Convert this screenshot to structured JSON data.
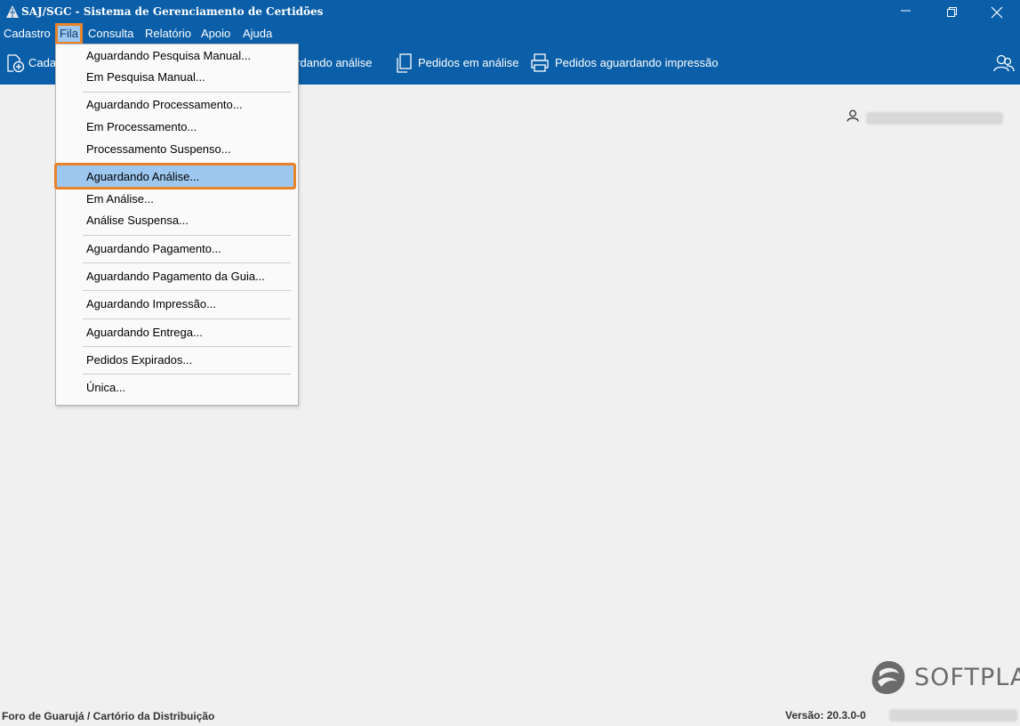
{
  "window": {
    "title": "SAJ/SGC - Sistema de Gerenciamento de Certidões",
    "controls": [
      "minimize-icon",
      "restore-icon",
      "close-icon"
    ]
  },
  "menubar": {
    "items": [
      {
        "label": "Cadastro"
      },
      {
        "label": "Fila",
        "active": true
      },
      {
        "label": "Consulta"
      },
      {
        "label": "Relatório"
      },
      {
        "label": "Apoio"
      },
      {
        "label": "Ajuda"
      }
    ]
  },
  "toolbar": {
    "items": [
      {
        "label": "Cada",
        "icon": "add-document-icon"
      },
      {
        "label": "ardando análise",
        "icon": ""
      },
      {
        "label": "Pedidos em análise",
        "icon": "documents-icon"
      },
      {
        "label": "Pedidos aguardando impressão",
        "icon": "printer-icon"
      }
    ],
    "right_icon": "users-icon"
  },
  "dropdown": {
    "items": [
      {
        "label": "Aguardando Pesquisa Manual..."
      },
      {
        "label": "Em Pesquisa Manual..."
      },
      {
        "label": "Aguardando Processamento..."
      },
      {
        "label": "Em Processamento..."
      },
      {
        "label": "Processamento Suspenso..."
      },
      {
        "label": "Aguardando Análise...",
        "highlighted": true
      },
      {
        "label": "Em Análise..."
      },
      {
        "label": "Análise Suspensa..."
      },
      {
        "label": "Aguardando Pagamento..."
      },
      {
        "label": "Aguardando Pagamento da Guia..."
      },
      {
        "label": "Aguardando Impressão..."
      },
      {
        "label": "Aguardando Entrega..."
      },
      {
        "label": "Pedidos Expirados..."
      },
      {
        "label": "Única..."
      }
    ]
  },
  "user": {
    "icon": "user-icon"
  },
  "brand": {
    "logo_text": "SOFTPLAN"
  },
  "statusbar": {
    "location": "Foro de Guarujá / Cartório da Distribuição",
    "version": "Versão: 20.3.0-0"
  },
  "colors": {
    "header_blue": "#0b5ea8",
    "highlight_orange": "#e8832a",
    "selection_blue": "#9dc7ef",
    "background": "#f0f0f0"
  }
}
